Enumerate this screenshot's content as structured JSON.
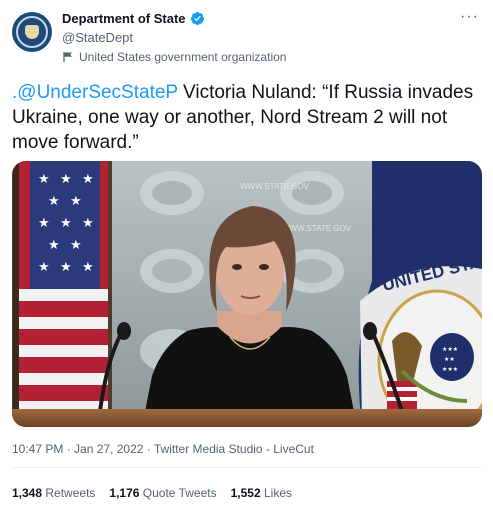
{
  "author": {
    "display_name": "Department of State",
    "handle": "@StateDept",
    "label": "United States government organization",
    "avatar_icon": "state-department-seal-icon",
    "verified_icon": "verified-badge-icon",
    "label_icon": "flag-icon"
  },
  "tweet": {
    "mention": ".@UnderSecStateP",
    "text": " Victoria Nuland: “If Russia invades Ukraine, one way or another, Nord Stream 2 will not move forward.”",
    "mention_color": "#1d9bf0"
  },
  "media": {
    "seal_text": "UNITED STA",
    "backdrop_text": "WWW.STATE.GOV"
  },
  "meta": {
    "timestamp": "10:47 PM · Jan 27, 2022 · Twitter Media Studio - LiveCut"
  },
  "stats": {
    "retweets_count": "1,348",
    "retweets_label": "Retweets",
    "quotes_count": "1,176",
    "quotes_label": "Quote Tweets",
    "likes_count": "1,552",
    "likes_label": "Likes"
  },
  "colors": {
    "text_primary": "#0f1419",
    "text_secondary": "#536471",
    "verified": "#1d9bf0"
  }
}
